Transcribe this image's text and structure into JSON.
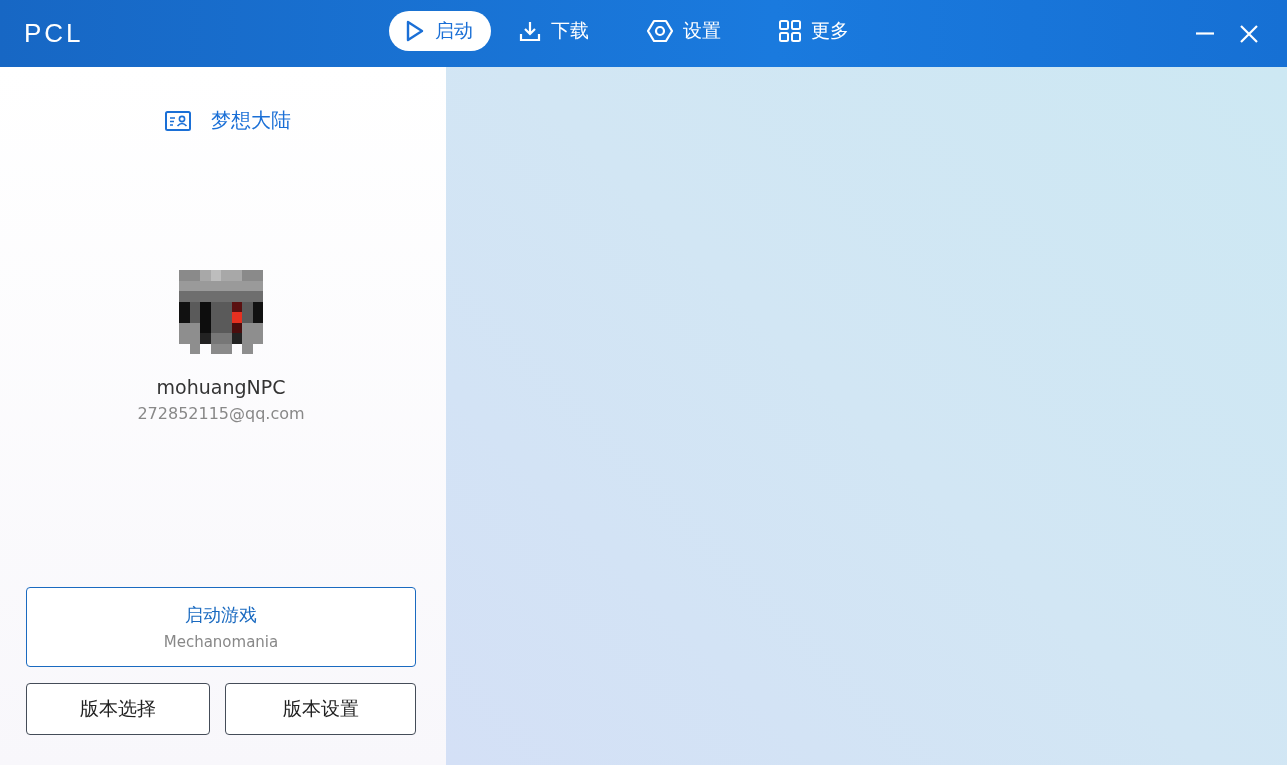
{
  "app": {
    "title": "PCL"
  },
  "tabs": [
    {
      "label": "启动",
      "selected": true
    },
    {
      "label": "下载",
      "selected": false
    },
    {
      "label": "设置",
      "selected": false
    },
    {
      "label": "更多",
      "selected": false
    }
  ],
  "login": {
    "server": "梦想大陆"
  },
  "profile": {
    "name": "mohuangNPC",
    "email": "272852115@qq.com"
  },
  "launch_button": {
    "label": "启动游戏",
    "version": "Mechanomania"
  },
  "buttons": [
    "版本选择",
    "版本设置"
  ]
}
